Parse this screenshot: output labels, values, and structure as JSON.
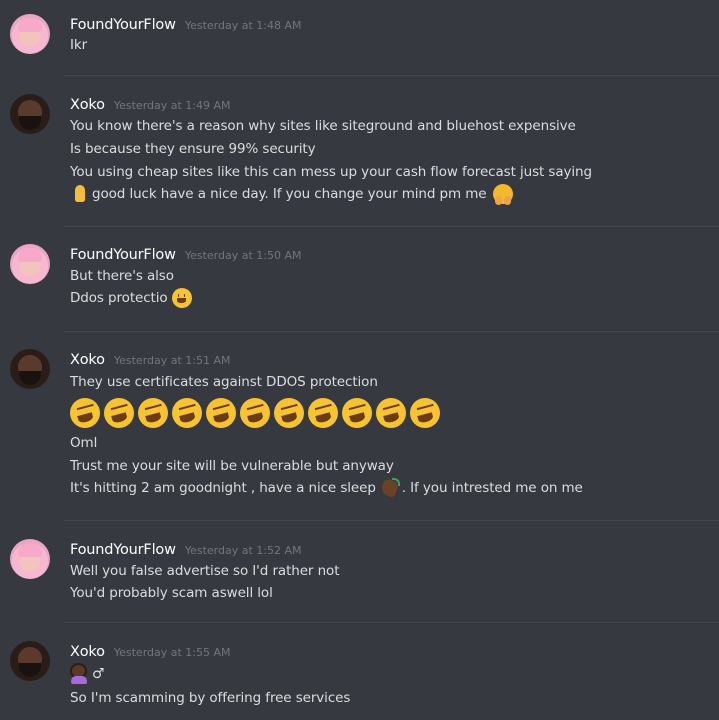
{
  "messages": [
    {
      "username": "FoundYourFlow",
      "timestamp": "Yesterday at 1:48 AM",
      "lines": [
        "Ikr"
      ]
    },
    {
      "username": "Xoko",
      "timestamp": "Yesterday at 1:49 AM",
      "lines": [
        "You know there's a reason why sites like siteground and bluehost expensive",
        "Is because they ensure 99% security",
        "You using cheap sites like this can mess up your cash flow forecast just saying",
        "good luck have a nice day. If you change your mind pm me"
      ]
    },
    {
      "username": "FoundYourFlow",
      "timestamp": "Yesterday at 1:50 AM",
      "lines": [
        "But there's also",
        "Ddos protectio"
      ]
    },
    {
      "username": "Xoko",
      "timestamp": "Yesterday at 1:51 AM",
      "lines": [
        "They use certificates against DDOS protection",
        "Oml",
        "Trust me your site will be vulnerable but anyway",
        "It's hitting 2 am goodnight , have a nice sleep",
        ". If you intrested me on me"
      ]
    },
    {
      "username": "FoundYourFlow",
      "timestamp": "Yesterday at 1:52 AM",
      "lines": [
        "Well you false advertise so I'd rather not",
        "You'd probably scam aswell lol"
      ]
    },
    {
      "username": "Xoko",
      "timestamp": "Yesterday at 1:55 AM",
      "lines": [
        "♂",
        "So I'm scamming by offering free services"
      ]
    }
  ],
  "icons": {
    "pray": "folded-hands-emoji",
    "hug": "hugging-face-emoji",
    "smile": "grinning-face-emoji",
    "laugh": "rolling-on-floor-laughing-emoji",
    "wave": "waving-hand-emoji",
    "facepalm": "person-facepalming-emoji"
  },
  "laugh_emoji_count": 11
}
